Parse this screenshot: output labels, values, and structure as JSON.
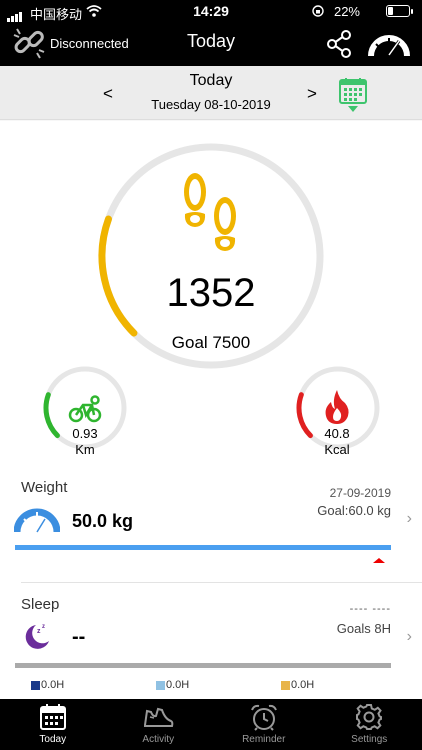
{
  "status_bar": {
    "carrier": "中国移动",
    "time": "14:29",
    "battery": "22%",
    "battery_level": 0.22
  },
  "header": {
    "connection_status": "Disconnected",
    "title": "Today"
  },
  "date_nav": {
    "day_label": "Today",
    "date": "Tuesday 08-10-2019",
    "prev": "<",
    "next": ">"
  },
  "steps": {
    "value": "1352",
    "goal_label": "Goal 7500",
    "progress": 0.18,
    "color": "#f0b400"
  },
  "distance": {
    "value": "0.93",
    "unit": "Km",
    "progress": 0.18,
    "color": "#2fb52f"
  },
  "calories": {
    "value": "40.8",
    "unit": "Kcal",
    "progress": 0.18,
    "color": "#e02020"
  },
  "weight": {
    "title": "Weight",
    "date": "27-09-2019",
    "goal": "Goal:60.0 kg",
    "value": "50.0 kg"
  },
  "sleep": {
    "title": "Sleep",
    "range": "---- ----",
    "goal": "Goals 8H",
    "value": "--",
    "legend": [
      {
        "value": "0.0H",
        "color": "#1a3a8a"
      },
      {
        "value": "0.0H",
        "color": "#8fc1e3"
      },
      {
        "value": "0.0H",
        "color": "#e8b44a"
      }
    ]
  },
  "tabs": [
    {
      "label": "Today",
      "icon": "calendar-icon",
      "active": true
    },
    {
      "label": "Activity",
      "icon": "shoe-icon",
      "active": false
    },
    {
      "label": "Reminder",
      "icon": "alarm-clock-icon",
      "active": false
    },
    {
      "label": "Settings",
      "icon": "gear-icon",
      "active": false
    }
  ],
  "colors": {
    "accent_green": "#3ec46d",
    "weight_bar": "#4a9ff0",
    "sleep_icon": "#6b2d9b"
  },
  "icons": [
    "signal-icon",
    "wifi-icon",
    "lock-rotation-icon",
    "battery-icon",
    "link-broken-icon",
    "share-icon",
    "speedometer-icon",
    "calendar-icon",
    "footprints-icon",
    "bike-icon",
    "flame-icon",
    "scale-gauge-icon",
    "moon-sleep-icon"
  ]
}
